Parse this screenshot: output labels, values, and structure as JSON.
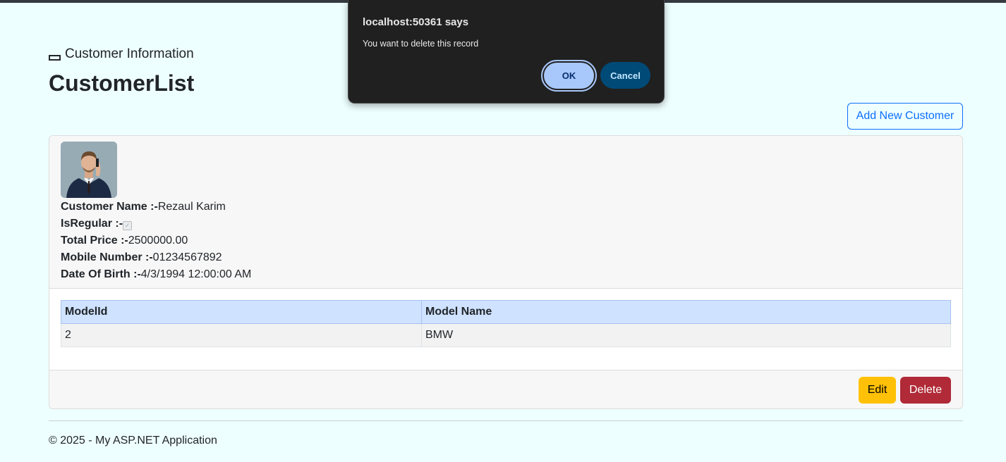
{
  "brand": {
    "label": "Customer Information"
  },
  "page": {
    "title": "CustomerList"
  },
  "toolbar": {
    "add_label": "Add New Customer"
  },
  "customer": {
    "name_label": "Customer Name :-",
    "name": "Rezaul Karim",
    "regular_label": "IsRegular :-",
    "is_regular": true,
    "price_label": "Total Price :-",
    "total_price": "2500000.00",
    "mobile_label": "Mobile Number :-",
    "mobile": "01234567892",
    "dob_label": "Date Of Birth :-",
    "dob": "4/3/1994 12:00:00 AM"
  },
  "models_table": {
    "headers": [
      "ModelId",
      "Model Name"
    ],
    "rows": [
      [
        "2",
        "BMW"
      ]
    ]
  },
  "actions": {
    "edit_label": "Edit",
    "delete_label": "Delete"
  },
  "footer": {
    "text": "© 2025 - My ASP.NET Application"
  },
  "dialog": {
    "title": "localhost:50361 says",
    "message": "You want to delete this record",
    "ok_label": "OK",
    "cancel_label": "Cancel"
  },
  "colors": {
    "page_bg": "#eeffff",
    "primary": "#0d6efd",
    "warning": "#ffc107",
    "danger": "#b02a37",
    "table_header": "#cfe2ff",
    "dialog_bg": "#202020"
  }
}
